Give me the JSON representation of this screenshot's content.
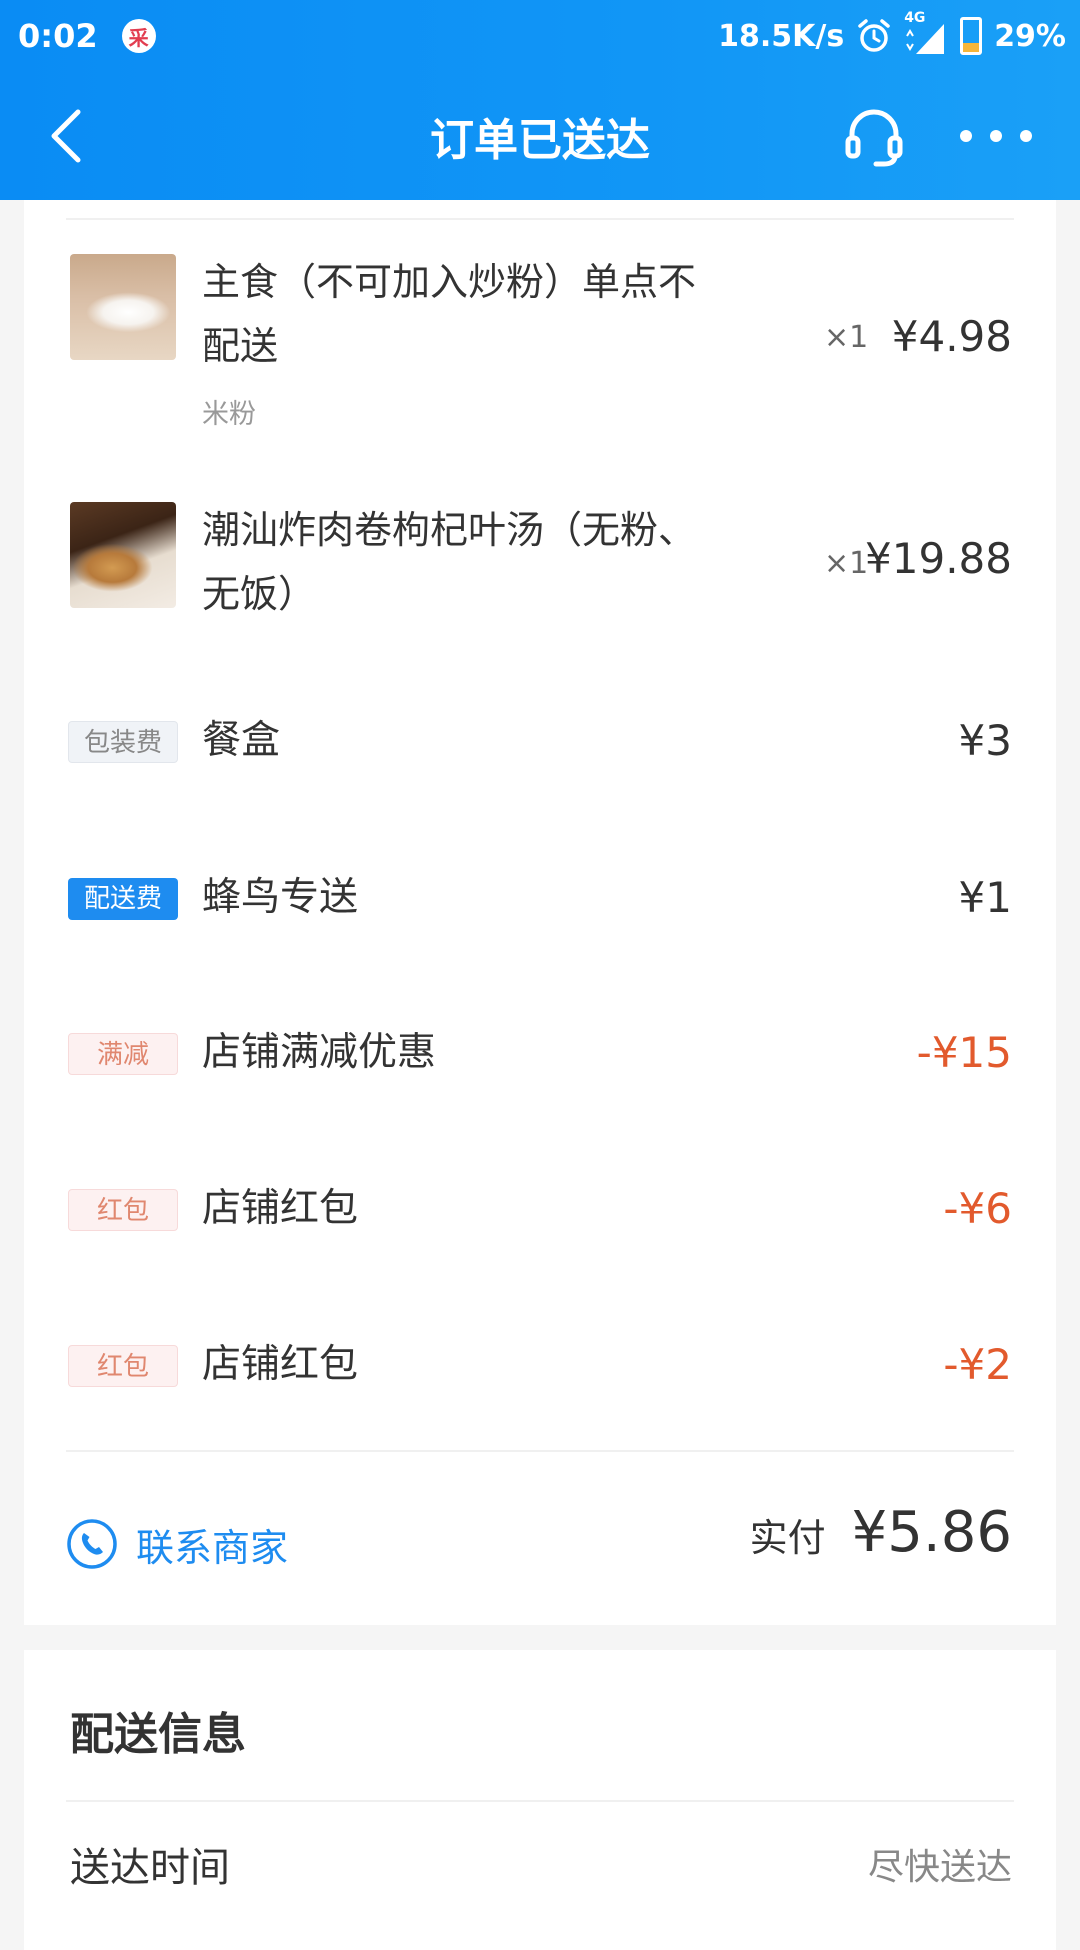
{
  "status_bar": {
    "time": "0:02",
    "app_badge": "采",
    "net_speed": "18.5K/s",
    "network": "4G",
    "battery_percent": "29%",
    "battery_level": 0.29
  },
  "nav": {
    "title": "订单已送达"
  },
  "items": [
    {
      "name": "主食（不可加入炒粉）单点不配送",
      "sub": "米粉",
      "qty": "×1",
      "price": "¥4.98"
    },
    {
      "name": "潮汕炸肉卷枸杞叶汤（无粉、无饭）",
      "sub": "",
      "qty": "×1",
      "price": "¥19.88"
    }
  ],
  "fees": [
    {
      "tag": "包装费",
      "label": "餐盒",
      "amount": "¥3"
    },
    {
      "tag": "配送费",
      "label": "蜂鸟专送",
      "amount": "¥1"
    },
    {
      "tag": "满减",
      "label": "店铺满减优惠",
      "amount": "-¥15"
    },
    {
      "tag": "红包",
      "label": "店铺红包",
      "amount": "-¥6"
    },
    {
      "tag": "红包",
      "label": "店铺红包",
      "amount": "-¥2"
    }
  ],
  "contact_label": "联系商家",
  "paid": {
    "label": "实付",
    "amount": "¥5.86"
  },
  "delivery": {
    "title": "配送信息",
    "time_label": "送达时间",
    "time_value": "尽快送达"
  },
  "colors": {
    "header_blue": "#0a8cf4",
    "link_blue": "#1e8cf0",
    "discount_red": "#e25a2d"
  }
}
